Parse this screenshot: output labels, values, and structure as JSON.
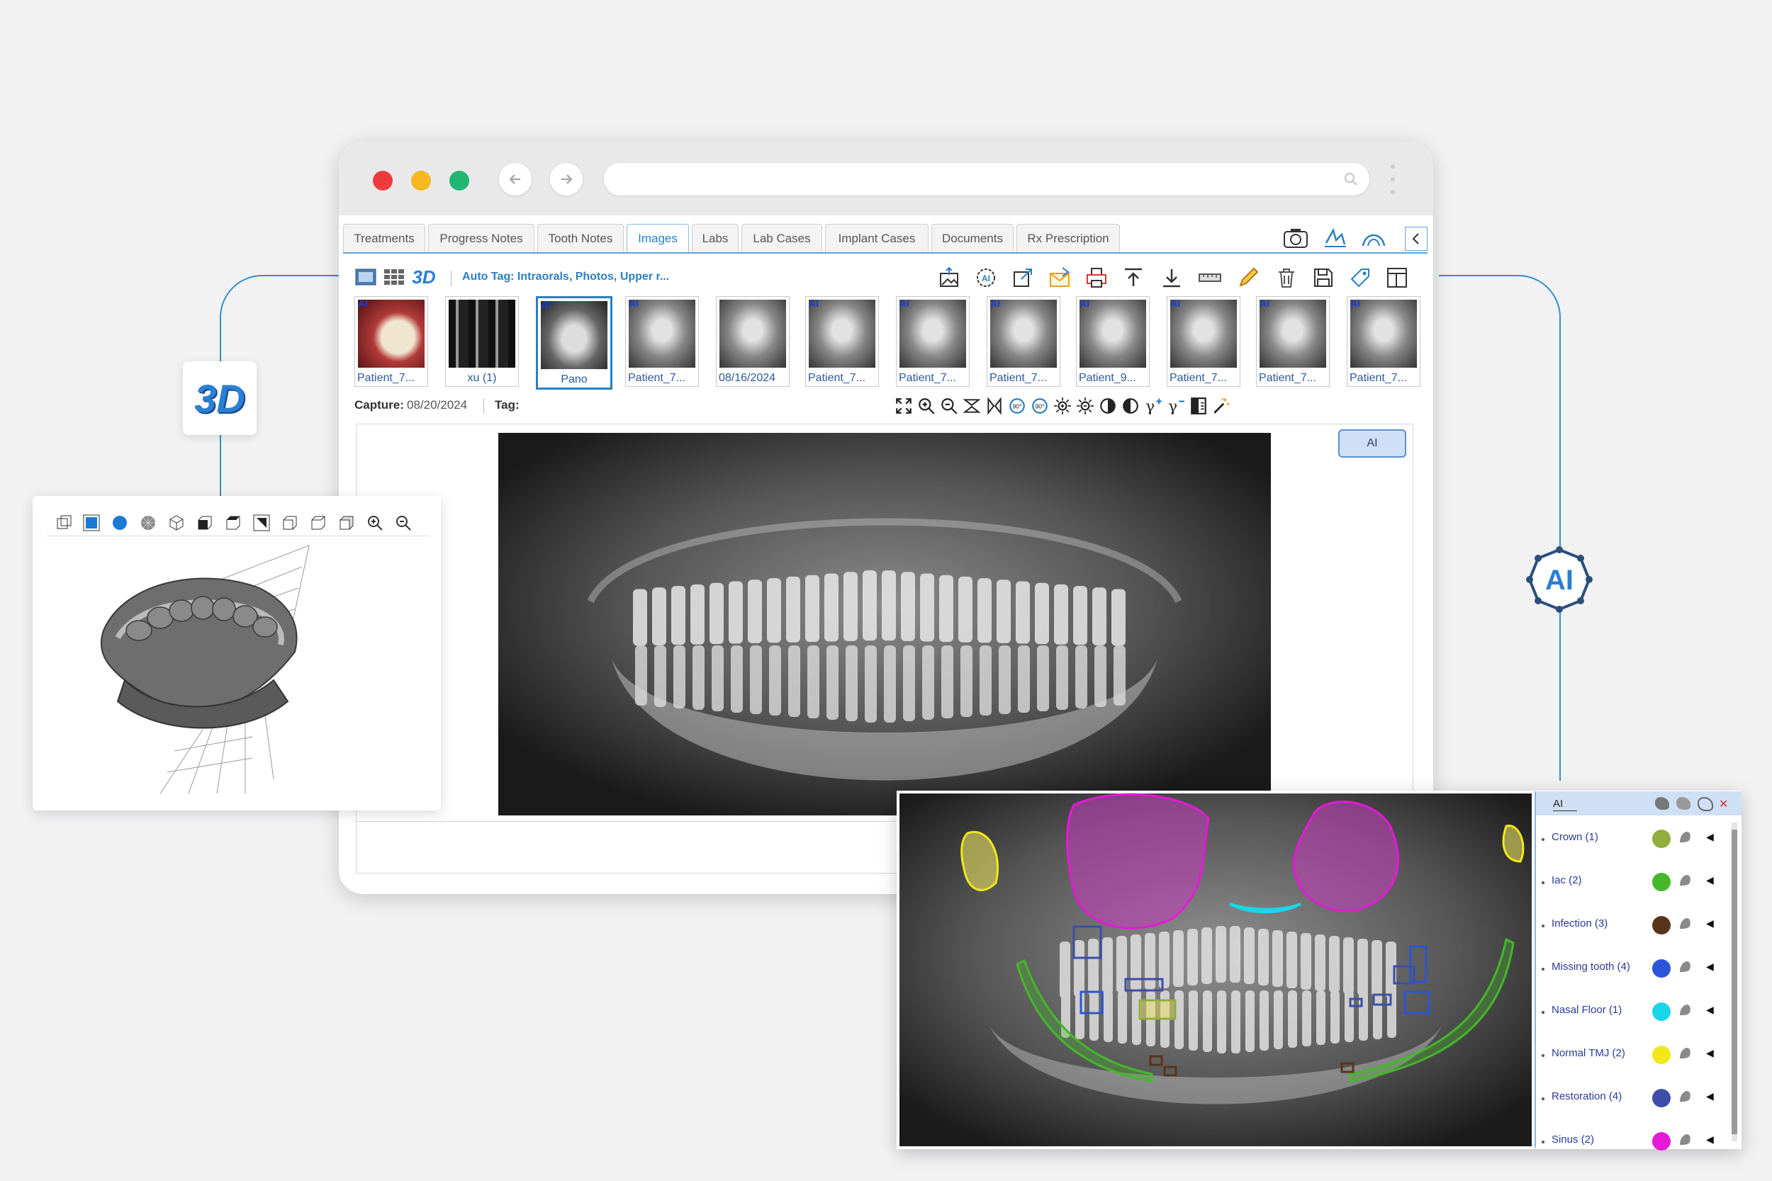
{
  "browser": {
    "tabs": [
      {
        "label": "Treatments",
        "active": false
      },
      {
        "label": "Progress Notes",
        "active": false
      },
      {
        "label": "Tooth Notes",
        "active": false
      },
      {
        "label": "Images",
        "active": true
      },
      {
        "label": "Labs",
        "active": false
      },
      {
        "label": "Lab Cases",
        "active": false
      },
      {
        "label": "Implant Cases",
        "active": false
      },
      {
        "label": "Documents",
        "active": false
      },
      {
        "label": "Rx Prescription",
        "active": false
      }
    ],
    "view_3d_label": "3D",
    "auto_tag": "Auto Tag: Intraorals, Photos, Upper r...",
    "thumbnails": [
      {
        "label": "Patient_7...",
        "ai": "AI",
        "kind": "photo"
      },
      {
        "label": "xu (1)",
        "ai": "",
        "kind": "fmx"
      },
      {
        "label": "Pano",
        "ai": "AI",
        "kind": "pano"
      },
      {
        "label": "Patient_7...",
        "ai": "AI",
        "kind": "xray"
      },
      {
        "label": "08/16/2024",
        "ai": "",
        "kind": "xray"
      },
      {
        "label": "Patient_7...",
        "ai": "AI",
        "kind": "xray"
      },
      {
        "label": "Patient_7...",
        "ai": "AI",
        "kind": "xray"
      },
      {
        "label": "Patient_7...",
        "ai": "AI",
        "kind": "xray"
      },
      {
        "label": "Patient_9...",
        "ai": "AI",
        "kind": "xray"
      },
      {
        "label": "Patient_7...",
        "ai": "AI",
        "kind": "xray"
      },
      {
        "label": "Patient_7...",
        "ai": "AI",
        "kind": "xray"
      },
      {
        "label": "Patient_7...",
        "ai": "AI",
        "kind": "xray"
      }
    ],
    "capture_label": "Capture:",
    "capture_date": "08/20/2024",
    "tag_label": "Tag:",
    "ai_button": "AI"
  },
  "badge_3d": "3D",
  "ai_badge": "AI",
  "ai_panel": {
    "header": "AI",
    "findings": [
      {
        "label": "Crown (1)",
        "color": "#8fae3c"
      },
      {
        "label": "Iac (2)",
        "color": "#45b82a"
      },
      {
        "label": "Infection (3)",
        "color": "#5a3418"
      },
      {
        "label": "Missing tooth (4)",
        "color": "#2b55d8"
      },
      {
        "label": "Nasal Floor (1)",
        "color": "#19d6e8"
      },
      {
        "label": "Normal TMJ (2)",
        "color": "#f0e81a"
      },
      {
        "label": "Restoration (4)",
        "color": "#3d4ea8"
      },
      {
        "label": "Sinus (2)",
        "color": "#e41ad6"
      }
    ]
  },
  "colors": {
    "accent": "#2a7fc4",
    "window_red": "#ee3c3c",
    "window_yellow": "#f5b820",
    "window_green": "#22b573"
  },
  "icons": [
    "camera-icon",
    "signature-icon",
    "tooth-icon",
    "collapse-icon",
    "image-import-icon",
    "ai-gear-icon",
    "export-icon",
    "email-icon",
    "print-icon",
    "upload-icon",
    "download-icon",
    "ruler-icon",
    "pencil-icon",
    "trash-icon",
    "save-icon",
    "tag-icon",
    "layout-icon",
    "fullscreen-icon",
    "zoom-in-icon",
    "zoom-out-icon",
    "flip-vertical-icon",
    "flip-horizontal-icon",
    "rotate-left-icon",
    "rotate-right-icon",
    "brightness-up-icon",
    "brightness-down-icon",
    "contrast-up-icon",
    "contrast-down-icon",
    "gamma-up-icon",
    "gamma-down-icon",
    "invert-icon",
    "magic-wand-icon"
  ]
}
